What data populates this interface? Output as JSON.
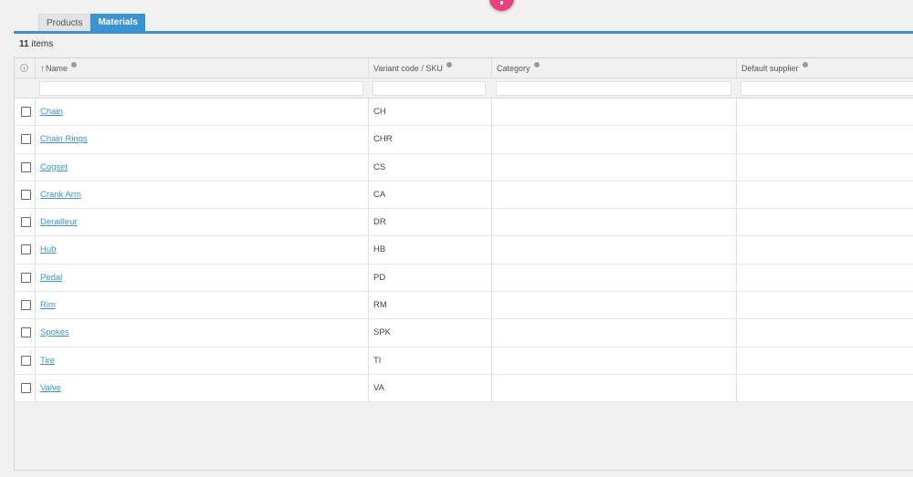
{
  "tabs": [
    {
      "label": "Products",
      "active": false
    },
    {
      "label": "Materials",
      "active": true
    }
  ],
  "item_count": {
    "number": "11",
    "label": " items"
  },
  "columns": {
    "name": "Name",
    "sku": "Variant code / SKU",
    "category": "Category",
    "supplier": "Default supplier"
  },
  "colors": {
    "accent": "#3a94d3",
    "fab": "#ec407a"
  },
  "rows": [
    {
      "name": "Chain",
      "sku": "CH"
    },
    {
      "name": "Chain Rings",
      "sku": "CHR"
    },
    {
      "name": "Cogset",
      "sku": "CS"
    },
    {
      "name": "Crank Arm",
      "sku": "CA"
    },
    {
      "name": "Derailleur",
      "sku": "DR"
    },
    {
      "name": "Hub",
      "sku": "HB"
    },
    {
      "name": "Pedal",
      "sku": "PD"
    },
    {
      "name": "Rim",
      "sku": "RM"
    },
    {
      "name": "Spokes",
      "sku": "SPK"
    },
    {
      "name": "Tire",
      "sku": "TI"
    },
    {
      "name": "Valve",
      "sku": "VA"
    }
  ]
}
